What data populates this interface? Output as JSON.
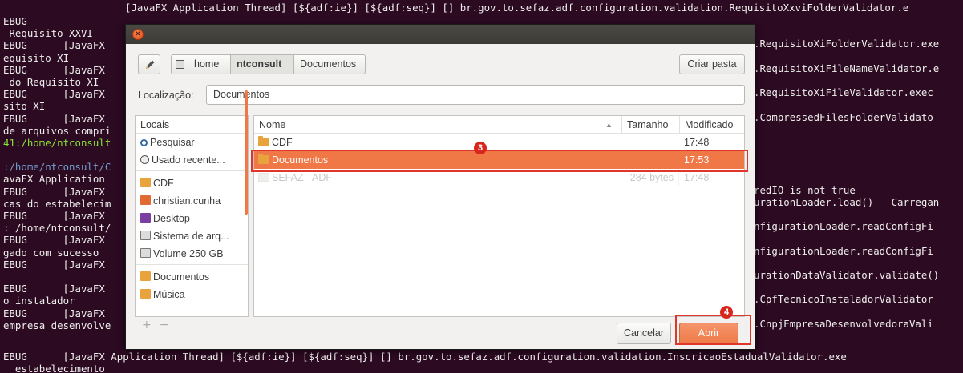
{
  "terminal": {
    "top_line": "[JavaFX Application Thread] [${adf:ie}] [${adf:seq}] [] br.gov.to.sefaz.adf.configuration.validation.RequisitoXxviFolderValidator.e",
    "left_lines": [
      {
        "text": "EBUG",
        "cls": ""
      },
      {
        "text": " Requisito XXVI",
        "cls": ""
      },
      {
        "text": "EBUG      [JavaFX",
        "cls": ""
      },
      {
        "text": "equisito XI",
        "cls": ""
      },
      {
        "text": "EBUG      [JavaFX",
        "cls": ""
      },
      {
        "text": " do Requisito XI",
        "cls": ""
      },
      {
        "text": "EBUG      [JavaFX",
        "cls": ""
      },
      {
        "text": "sito XI",
        "cls": ""
      },
      {
        "text": "EBUG      [JavaFX",
        "cls": ""
      },
      {
        "text": "de arquivos compri",
        "cls": ""
      },
      {
        "text": "41:/home/ntconsult",
        "cls": "path"
      },
      {
        "text": "",
        "cls": ""
      },
      {
        "text": ":/home/ntconsult/C",
        "cls": "path2"
      },
      {
        "text": "avaFX Application",
        "cls": ""
      },
      {
        "text": "EBUG      [JavaFX",
        "cls": ""
      },
      {
        "text": "cas do estabelecim",
        "cls": ""
      },
      {
        "text": "EBUG      [JavaFX",
        "cls": ""
      },
      {
        "text": ": /home/ntconsult/",
        "cls": ""
      },
      {
        "text": "EBUG      [JavaFX",
        "cls": ""
      },
      {
        "text": "gado com sucesso",
        "cls": ""
      },
      {
        "text": "EBUG      [JavaFX",
        "cls": ""
      },
      {
        "text": "",
        "cls": ""
      },
      {
        "text": "EBUG      [JavaFX",
        "cls": ""
      },
      {
        "text": "o instalador",
        "cls": ""
      },
      {
        "text": "EBUG      [JavaFX",
        "cls": ""
      },
      {
        "text": "empresa desenvolve",
        "cls": ""
      }
    ],
    "right_lines": [
      "",
      "",
      ".RequisitoXiFolderValidator.exe",
      "",
      ".RequisitoXiFileNameValidator.e",
      "",
      ".RequisitoXiFileValidator.exec",
      "",
      ".CompressedFilesFolderValidato",
      "",
      "",
      "",
      "",
      "",
      "redIO is not true",
      "urationLoader.load() - Carregan",
      "",
      "nfigurationLoader.readConfigFi",
      "",
      "nfigurationLoader.readConfigFi",
      "",
      "urationDataValidator.validate()",
      "",
      ".CpfTecnicoInstaladorValidator",
      "",
      ".CnpjEmpresaDesenvolvedoraVali"
    ],
    "bottom_lines": [
      "EBUG      [JavaFX Application Thread] [${adf:ie}] [${adf:seq}] [] br.gov.to.sefaz.adf.configuration.validation.InscricaoEstadualValidator.exe",
      "  estabelecimento"
    ]
  },
  "dialog": {
    "path_bar": {
      "segments": [
        "home",
        "ntconsult",
        "Documentos"
      ]
    },
    "create_folder_label": "Criar pasta",
    "location_label": "Localização:",
    "location_value": "Documentos",
    "places": {
      "header": "Locais",
      "items": [
        {
          "label": "Pesquisar",
          "icon": "search-icon"
        },
        {
          "label": "Usado recente...",
          "icon": "recent-icon"
        },
        {
          "label": "CDF",
          "icon": "folder-icon"
        },
        {
          "label": "christian.cunha",
          "icon": "home-folder-icon"
        },
        {
          "label": "Desktop",
          "icon": "desktop-icon"
        },
        {
          "label": "Sistema de arq...",
          "icon": "drive-icon"
        },
        {
          "label": "Volume 250 GB",
          "icon": "drive-icon"
        },
        {
          "label": "Documentos",
          "icon": "documents-folder-icon"
        },
        {
          "label": "Música",
          "icon": "music-folder-icon"
        }
      ]
    },
    "files": {
      "columns": {
        "name": "Nome",
        "size": "Tamanho",
        "modified": "Modificado"
      },
      "rows": [
        {
          "name": "CDF",
          "size": "",
          "modified": "17:48",
          "type": "folder",
          "state": "normal"
        },
        {
          "name": "Documentos",
          "size": "",
          "modified": "17:53",
          "type": "folder",
          "state": "selected"
        },
        {
          "name": "SEFAZ - ADF",
          "size": "284 bytes",
          "modified": "17:48",
          "type": "file",
          "state": "disabled"
        }
      ]
    },
    "cancel_label": "Cancelar",
    "open_label": "Abrir"
  },
  "annotations": {
    "step_row": "3",
    "step_open": "4"
  },
  "colors": {
    "terminal_bg": "#2c0a22",
    "accent": "#f07746",
    "highlight": "#e0362a"
  }
}
